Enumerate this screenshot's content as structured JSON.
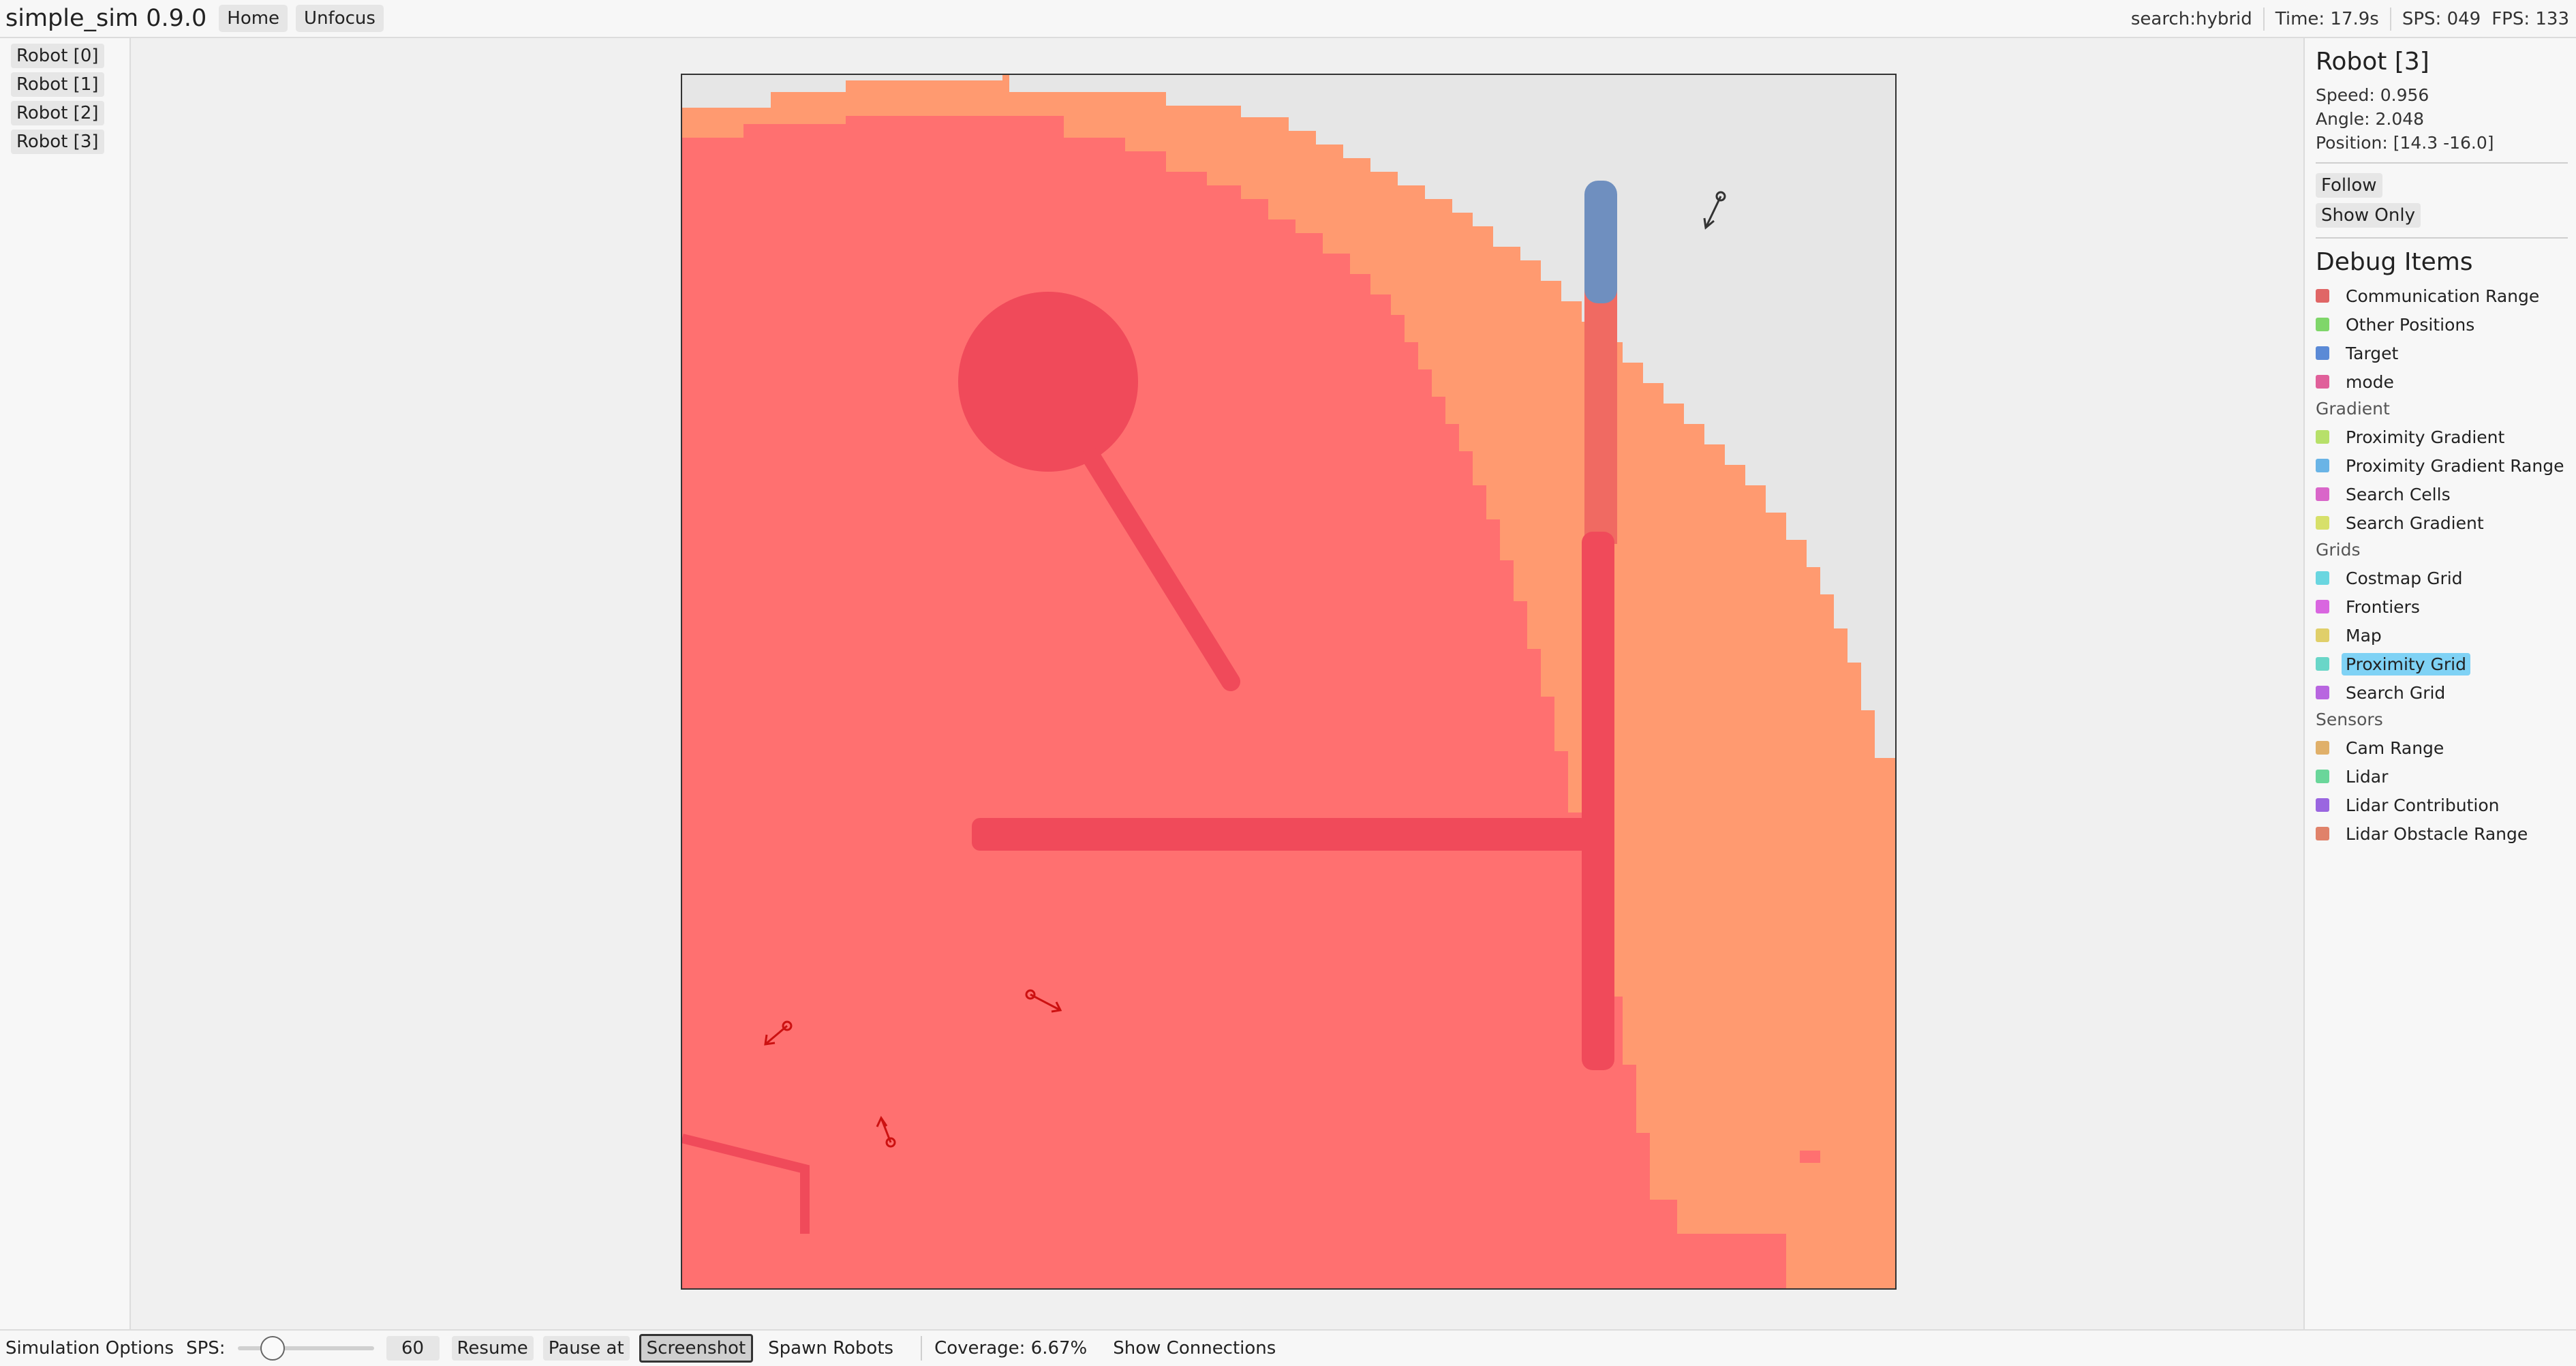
{
  "app": {
    "title": "simple_sim 0.9.0",
    "home_label": "Home",
    "unfocus_label": "Unfocus",
    "search_mode": "search:hybrid",
    "time": "Time: 17.9s",
    "sps": "SPS: 049",
    "fps": "FPS: 133"
  },
  "robot_list": [
    "Robot [0]",
    "Robot [1]",
    "Robot [2]",
    "Robot [3]"
  ],
  "robot_details": {
    "title": "Robot [3]",
    "speed": "Speed: 0.956",
    "angle": "Angle: 2.048",
    "position": "Position: [14.3 -16.0]",
    "follow_label": "Follow",
    "show_only_label": "Show Only"
  },
  "debug": {
    "title": "Debug Items",
    "top_items": [
      {
        "label": "Communication Range",
        "color": "#e06666"
      },
      {
        "label": "Other Positions",
        "color": "#7fd66a"
      },
      {
        "label": "Target",
        "color": "#5b8ad6"
      },
      {
        "label": "mode",
        "color": "#e0609a"
      }
    ],
    "groups": [
      {
        "label": "Gradient",
        "items": [
          {
            "label": "Proximity Gradient",
            "color": "#b7e06a"
          },
          {
            "label": "Proximity Gradient Range",
            "color": "#6ab4e6"
          },
          {
            "label": "Search Cells",
            "color": "#d966c9"
          },
          {
            "label": "Search Gradient",
            "color": "#d7e06a"
          }
        ]
      },
      {
        "label": "Grids",
        "items": [
          {
            "label": "Costmap Grid",
            "color": "#6ad6e0"
          },
          {
            "label": "Frontiers",
            "color": "#d966e0"
          },
          {
            "label": "Map",
            "color": "#e0cf6a"
          },
          {
            "label": "Proximity Grid",
            "color": "#6ad6c8",
            "selected": true
          },
          {
            "label": "Search Grid",
            "color": "#b866e0"
          }
        ]
      },
      {
        "label": "Sensors",
        "items": [
          {
            "label": "Cam Range",
            "color": "#e0b06a"
          },
          {
            "label": "Lidar",
            "color": "#6ad69a"
          },
          {
            "label": "Lidar Contribution",
            "color": "#9a66e0"
          },
          {
            "label": "Lidar Obstacle Range",
            "color": "#e0826a"
          }
        ]
      }
    ]
  },
  "bottom": {
    "sim_options_label": "Simulation Options",
    "sps_label": "SPS:",
    "sps_slider_fraction": 0.2,
    "sps_value": "60",
    "resume_label": "Resume",
    "pause_at_label": "Pause at",
    "screenshot_label": "Screenshot",
    "spawn_label": "Spawn Robots",
    "coverage": "Coverage: 6.67%",
    "show_connections_label": "Show Connections"
  },
  "colors": {
    "background_unexplored": "#e6e6e6",
    "outer_band": "#ff9a70",
    "explored_area": "#ff7070",
    "obstacle": "#f04a5a",
    "target": "#6f8fbf",
    "robot_marker": "#cc1111",
    "robot_marker_dark": "#333333"
  }
}
